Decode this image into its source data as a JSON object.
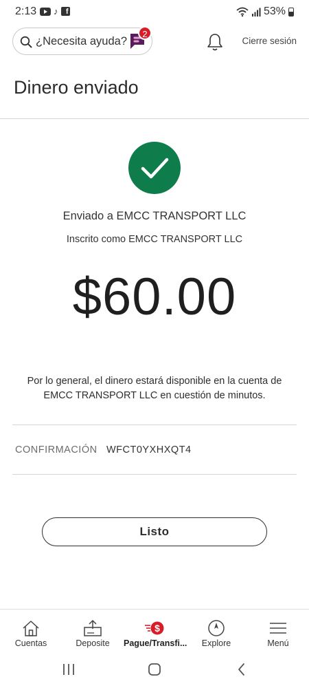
{
  "status_bar": {
    "time": "2:13",
    "battery": "53%"
  },
  "header": {
    "search_placeholder": "¿Necesita ayuda?",
    "badge_count": "2",
    "logout_label": "Cierre sesión"
  },
  "page": {
    "title": "Dinero enviado"
  },
  "confirmation": {
    "sent_to": "Enviado a EMCC TRANSPORT LLC",
    "enrolled_as": "Inscrito como EMCC TRANSPORT LLC",
    "amount": "$60.00",
    "availability": "Por lo general, el dinero estará disponible en la cuenta de EMCC TRANSPORT LLC en cuestión de minutos.",
    "confirmation_label": "CONFIRMACIÓN",
    "confirmation_number": "WFCT0YXHXQT4",
    "done_label": "Listo"
  },
  "bottom_nav": {
    "items": [
      {
        "label": "Cuentas",
        "icon": "home-icon"
      },
      {
        "label": "Deposite",
        "icon": "deposit-icon"
      },
      {
        "label": "Pague/Transfi...",
        "icon": "pay-transfer-icon",
        "active": true
      },
      {
        "label": "Explore",
        "icon": "compass-icon"
      },
      {
        "label": "Menú",
        "icon": "menu-icon"
      }
    ]
  },
  "colors": {
    "success_green": "#0f7d4b",
    "brand_red": "#d71e28",
    "assistant_purple": "#5a1a5e"
  }
}
